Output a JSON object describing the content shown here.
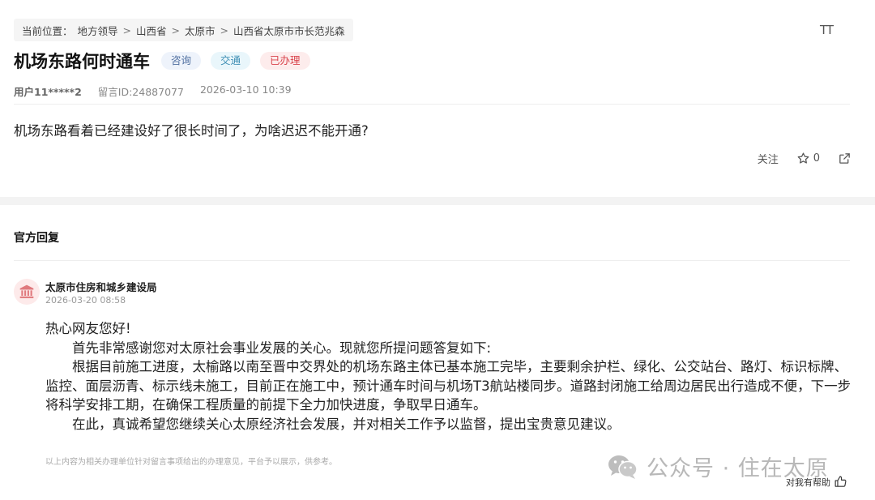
{
  "breadcrumb": {
    "prefix": "当前位置：",
    "items": [
      "地方领导",
      "山西省",
      "太原市",
      "山西省太原市市长范兆森"
    ],
    "separator": ">"
  },
  "font_size_control": "TT",
  "message": {
    "title": "机场东路何时通车",
    "tags": [
      "咨询",
      "交通",
      "已办理"
    ],
    "user": "用户11*****2",
    "message_id": "留言ID:24887077",
    "datetime": "2026-03-10 10:39",
    "content": "机场东路看着已经建设好了很长时间了，为啥迟迟不能开通?"
  },
  "actions": {
    "follow_label": "关注",
    "star_count": "0"
  },
  "reply": {
    "header": "官方回复",
    "org_name": "太原市住房和城乡建设局",
    "datetime": "2026-03-20 08:58",
    "greeting": "热心网友您好!",
    "paragraphs": [
      "首先非常感谢您对太原社会事业发展的关心。现就您所提问题答复如下:",
      "根据目前施工进度，太榆路以南至晋中交界处的机场东路主体已基本施工完毕，主要剩余护栏、绿化、公交站台、路灯、标识标牌、监控、面层沥青、标示线未施工，目前正在施工中，预计通车时间与机场T3航站楼同步。道路封闭施工给周边居民出行造成不便，下一步将科学安排工期，在确保工程质量的前提下全力加快进度，争取早日通车。",
      "在此，真诚希望您继续关心太原经济社会发展，并对相关工作予以监督，提出宝贵意见建议。"
    ],
    "disclaimer": "以上内容为相关办理单位针对留言事项给出的办理意见，平台予以展示，供参考。",
    "helpful_label": "对我有帮助"
  },
  "watermark": {
    "text": "公众号 · 住在太原"
  },
  "colors": {
    "tag_consult_bg": "#eef3fb",
    "tag_traffic_bg": "#e9f6fb",
    "tag_done_bg": "#fdecec",
    "tag_done_text": "#d9434b",
    "org_icon": "#e0797d"
  },
  "icons": [
    "font-size-icon",
    "star-icon",
    "share-icon",
    "government-building-icon",
    "wechat-icon",
    "thumbs-up-icon"
  ]
}
